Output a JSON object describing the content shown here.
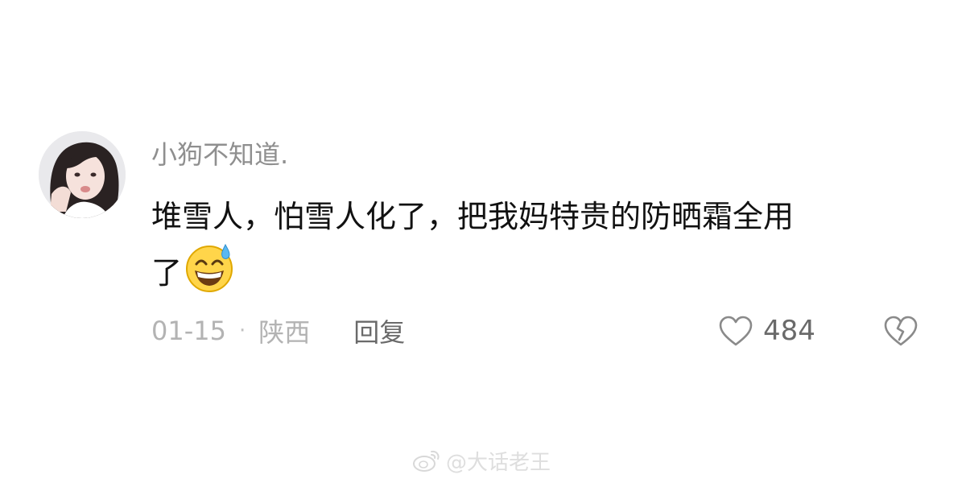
{
  "comment": {
    "username": "小狗不知道.",
    "text_line_1": "堆雪人，怕雪人化了，把我妈特贵的防晒霜全用",
    "text_line_2": "了",
    "emoji": "grinning-face-with-sweat",
    "date": "01-15",
    "separator": "·",
    "location": "陕西",
    "reply_label": "回复",
    "like_count": "484"
  },
  "watermark": {
    "text": "@大话老王"
  },
  "icons": {
    "avatar": "user-avatar-photo",
    "like": "heart-outline-icon",
    "dislike": "broken-heart-outline-icon",
    "watermark_logo": "weibo-logo-icon"
  },
  "colors": {
    "username": "#8f8f8f",
    "text": "#111111",
    "meta": "#b3b3b3",
    "action": "#6a6a6a"
  }
}
